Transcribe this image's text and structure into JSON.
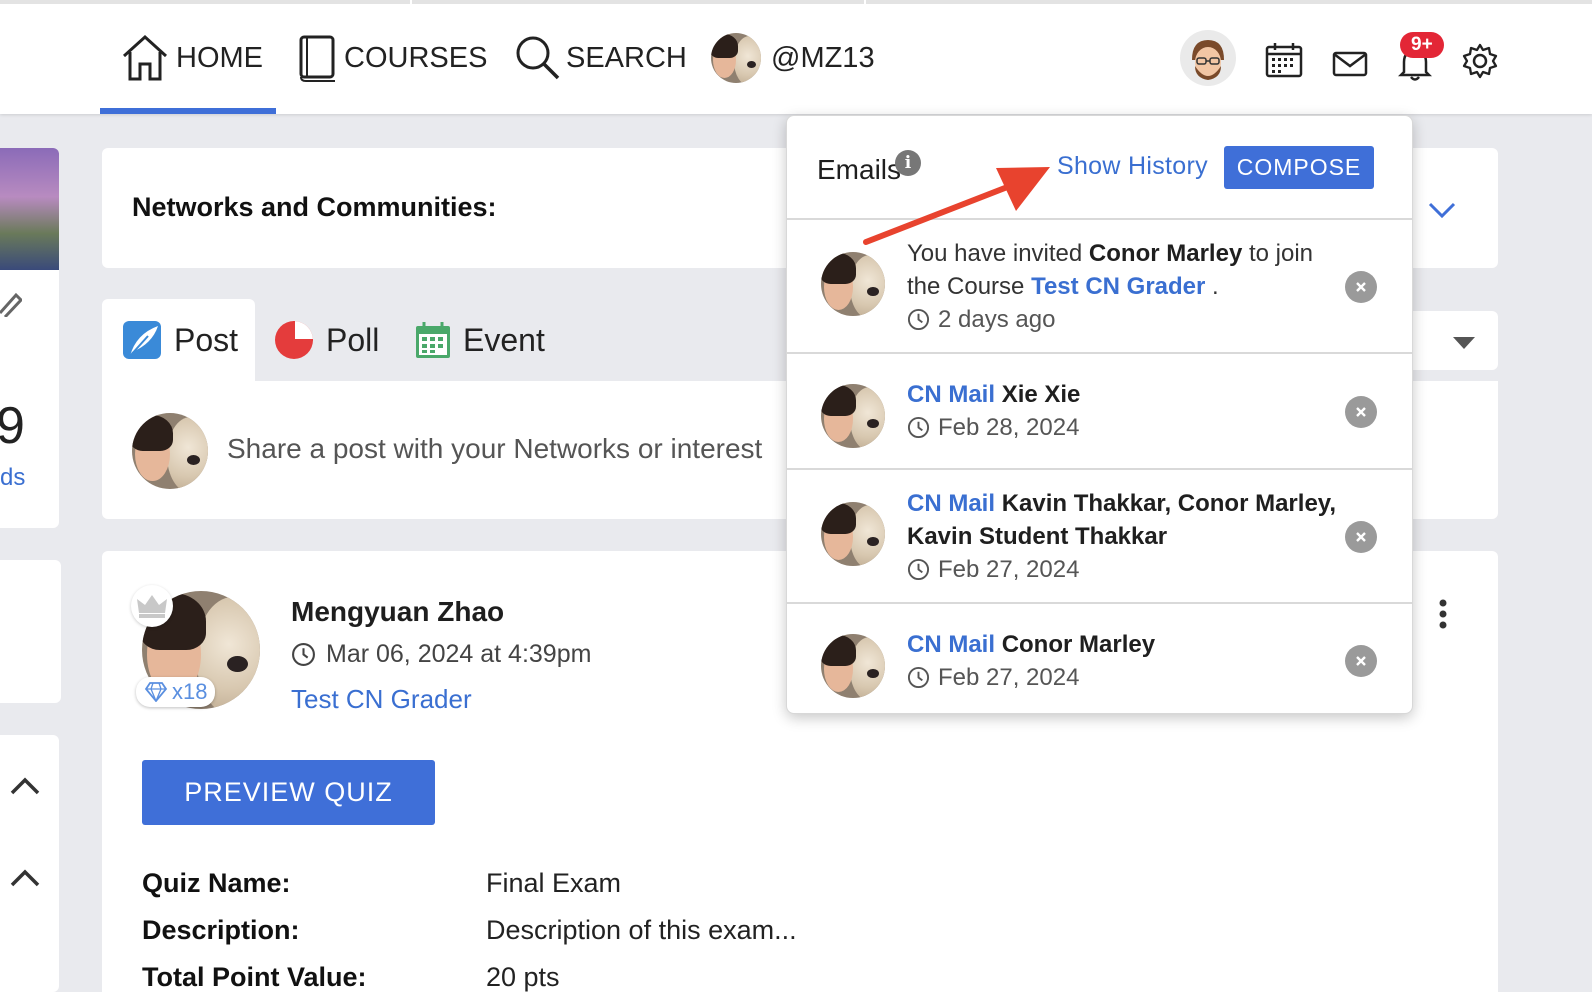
{
  "nav": {
    "home": "HOME",
    "courses": "COURSES",
    "search": "SEARCH",
    "username": "@MZ13",
    "notification_badge": "9+",
    "accent_color": "#3f6fd8"
  },
  "left": {
    "partial_number": "9",
    "partial_link": "ds"
  },
  "networks": {
    "title": "Networks and Communities:"
  },
  "composer": {
    "tabs": [
      {
        "label": "Post",
        "icon": "feather-icon"
      },
      {
        "label": "Poll",
        "icon": "pie-chart-icon"
      },
      {
        "label": "Event",
        "icon": "calendar-icon"
      }
    ],
    "share_placeholder": "Share a post with your Networks or interest"
  },
  "post": {
    "author": "Mengyuan Zhao",
    "date": "Mar 06, 2024 at 4:39pm",
    "course": "Test CN Grader",
    "gem_count": "x18",
    "preview_button": "PREVIEW QUIZ",
    "fields": [
      {
        "label": "Quiz Name:",
        "value": "Final Exam"
      },
      {
        "label": "Description:",
        "value": "Description of this exam..."
      },
      {
        "label": "Total Point Value:",
        "value": "20 pts"
      }
    ]
  },
  "emails": {
    "title": "Emails",
    "show_history": "Show History",
    "compose": "COMPOSE",
    "items": [
      {
        "prefix": "You have invited ",
        "person": "Conor Marley",
        "mid": " to join the Course ",
        "course": "Test CN Grader",
        "suffix": " .",
        "time": "2 days ago"
      },
      {
        "link": "CN Mail",
        "names": "Xie Xie",
        "time": "Feb 28, 2024"
      },
      {
        "link": "CN Mail",
        "names": "Kavin Thakkar, Conor Marley, Kavin Student Thakkar",
        "time": "Feb 27, 2024"
      },
      {
        "link": "CN Mail",
        "names": "Conor Marley",
        "time": "Feb 27, 2024"
      }
    ]
  }
}
